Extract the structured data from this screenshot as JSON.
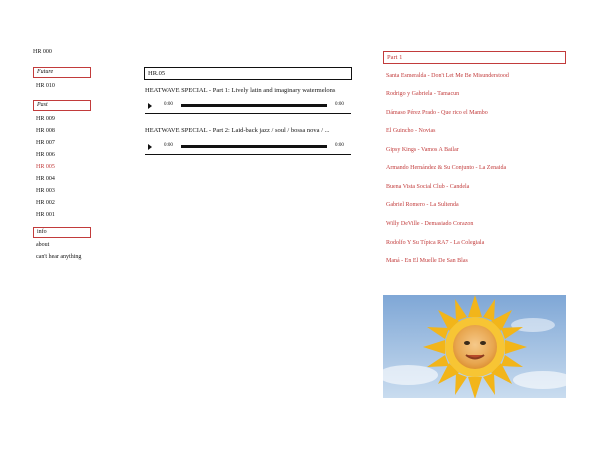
{
  "header": {
    "title": "HR 000"
  },
  "sidebar": {
    "future": {
      "label": "Future",
      "items": [
        "HR 010"
      ]
    },
    "past": {
      "label": "Past",
      "items": [
        "HR 009",
        "HR 008",
        "HR 007",
        "HR 006",
        "HR 005",
        "HR 004",
        "HR 003",
        "HR 002",
        "HR 001"
      ],
      "active_index": 4
    },
    "info": {
      "label": "info",
      "items": [
        "about",
        "can't hear anything"
      ]
    }
  },
  "main": {
    "episode_label": "HR.05",
    "episodes": [
      {
        "title": "HEATWAVE SPECIAL - Part 1: Lively latin and imaginary watermelons",
        "time_start": "0:00",
        "time_end": "0:00",
        "progress": 0
      },
      {
        "title": "HEATWAVE SPECIAL - Part 2: Laid-back jazz / soul / bossa nova / ...",
        "time_start": "0:00",
        "time_end": "0:00",
        "progress": 0
      }
    ]
  },
  "tracklist": {
    "heading": "Part 1",
    "tracks": [
      "Santa Esmeralda - Don't Let Me Be Misunderstood",
      "Rodrigo y Gabriela - Tamacun",
      "Dámaso Pérez Prado - Que rico el Mambo",
      "El Guincho - Novias",
      "Gipsy Kings - Vamos A Bailar",
      "Armando Hernández & Su Conjunto - La Zenaida",
      "Buena Vista Social Club - Candela",
      "Gabriel Romero - La Sultenda",
      "Willy DeVille - Demasiado Corazon",
      "Rodolfo Y Su Típica RA7 - La Colegiala",
      "Maná - En El Muelle De San Blas"
    ]
  },
  "image": {
    "description_icon": "sun-baby-icon"
  },
  "colors": {
    "accent": "#c23b3b",
    "text": "#111111",
    "sky": "#a9c7e6"
  }
}
